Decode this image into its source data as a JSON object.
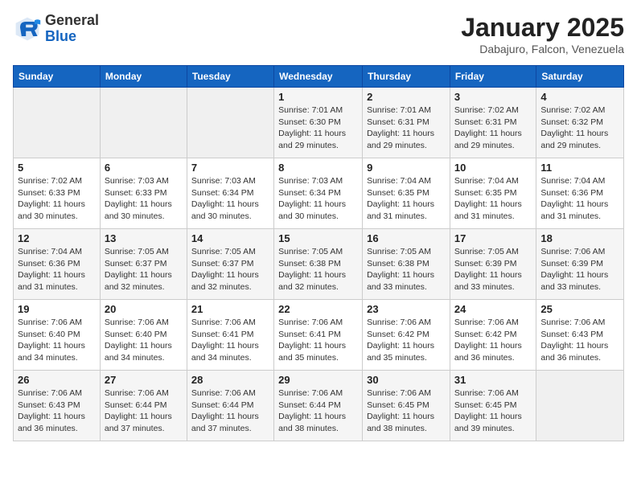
{
  "header": {
    "logo_general": "General",
    "logo_blue": "Blue",
    "title": "January 2025",
    "subtitle": "Dabajuro, Falcon, Venezuela"
  },
  "weekdays": [
    "Sunday",
    "Monday",
    "Tuesday",
    "Wednesday",
    "Thursday",
    "Friday",
    "Saturday"
  ],
  "weeks": [
    [
      {
        "day": "",
        "info": ""
      },
      {
        "day": "",
        "info": ""
      },
      {
        "day": "",
        "info": ""
      },
      {
        "day": "1",
        "info": "Sunrise: 7:01 AM\nSunset: 6:30 PM\nDaylight: 11 hours and 29 minutes."
      },
      {
        "day": "2",
        "info": "Sunrise: 7:01 AM\nSunset: 6:31 PM\nDaylight: 11 hours and 29 minutes."
      },
      {
        "day": "3",
        "info": "Sunrise: 7:02 AM\nSunset: 6:31 PM\nDaylight: 11 hours and 29 minutes."
      },
      {
        "day": "4",
        "info": "Sunrise: 7:02 AM\nSunset: 6:32 PM\nDaylight: 11 hours and 29 minutes."
      }
    ],
    [
      {
        "day": "5",
        "info": "Sunrise: 7:02 AM\nSunset: 6:33 PM\nDaylight: 11 hours and 30 minutes."
      },
      {
        "day": "6",
        "info": "Sunrise: 7:03 AM\nSunset: 6:33 PM\nDaylight: 11 hours and 30 minutes."
      },
      {
        "day": "7",
        "info": "Sunrise: 7:03 AM\nSunset: 6:34 PM\nDaylight: 11 hours and 30 minutes."
      },
      {
        "day": "8",
        "info": "Sunrise: 7:03 AM\nSunset: 6:34 PM\nDaylight: 11 hours and 30 minutes."
      },
      {
        "day": "9",
        "info": "Sunrise: 7:04 AM\nSunset: 6:35 PM\nDaylight: 11 hours and 31 minutes."
      },
      {
        "day": "10",
        "info": "Sunrise: 7:04 AM\nSunset: 6:35 PM\nDaylight: 11 hours and 31 minutes."
      },
      {
        "day": "11",
        "info": "Sunrise: 7:04 AM\nSunset: 6:36 PM\nDaylight: 11 hours and 31 minutes."
      }
    ],
    [
      {
        "day": "12",
        "info": "Sunrise: 7:04 AM\nSunset: 6:36 PM\nDaylight: 11 hours and 31 minutes."
      },
      {
        "day": "13",
        "info": "Sunrise: 7:05 AM\nSunset: 6:37 PM\nDaylight: 11 hours and 32 minutes."
      },
      {
        "day": "14",
        "info": "Sunrise: 7:05 AM\nSunset: 6:37 PM\nDaylight: 11 hours and 32 minutes."
      },
      {
        "day": "15",
        "info": "Sunrise: 7:05 AM\nSunset: 6:38 PM\nDaylight: 11 hours and 32 minutes."
      },
      {
        "day": "16",
        "info": "Sunrise: 7:05 AM\nSunset: 6:38 PM\nDaylight: 11 hours and 33 minutes."
      },
      {
        "day": "17",
        "info": "Sunrise: 7:05 AM\nSunset: 6:39 PM\nDaylight: 11 hours and 33 minutes."
      },
      {
        "day": "18",
        "info": "Sunrise: 7:06 AM\nSunset: 6:39 PM\nDaylight: 11 hours and 33 minutes."
      }
    ],
    [
      {
        "day": "19",
        "info": "Sunrise: 7:06 AM\nSunset: 6:40 PM\nDaylight: 11 hours and 34 minutes."
      },
      {
        "day": "20",
        "info": "Sunrise: 7:06 AM\nSunset: 6:40 PM\nDaylight: 11 hours and 34 minutes."
      },
      {
        "day": "21",
        "info": "Sunrise: 7:06 AM\nSunset: 6:41 PM\nDaylight: 11 hours and 34 minutes."
      },
      {
        "day": "22",
        "info": "Sunrise: 7:06 AM\nSunset: 6:41 PM\nDaylight: 11 hours and 35 minutes."
      },
      {
        "day": "23",
        "info": "Sunrise: 7:06 AM\nSunset: 6:42 PM\nDaylight: 11 hours and 35 minutes."
      },
      {
        "day": "24",
        "info": "Sunrise: 7:06 AM\nSunset: 6:42 PM\nDaylight: 11 hours and 36 minutes."
      },
      {
        "day": "25",
        "info": "Sunrise: 7:06 AM\nSunset: 6:43 PM\nDaylight: 11 hours and 36 minutes."
      }
    ],
    [
      {
        "day": "26",
        "info": "Sunrise: 7:06 AM\nSunset: 6:43 PM\nDaylight: 11 hours and 36 minutes."
      },
      {
        "day": "27",
        "info": "Sunrise: 7:06 AM\nSunset: 6:44 PM\nDaylight: 11 hours and 37 minutes."
      },
      {
        "day": "28",
        "info": "Sunrise: 7:06 AM\nSunset: 6:44 PM\nDaylight: 11 hours and 37 minutes."
      },
      {
        "day": "29",
        "info": "Sunrise: 7:06 AM\nSunset: 6:44 PM\nDaylight: 11 hours and 38 minutes."
      },
      {
        "day": "30",
        "info": "Sunrise: 7:06 AM\nSunset: 6:45 PM\nDaylight: 11 hours and 38 minutes."
      },
      {
        "day": "31",
        "info": "Sunrise: 7:06 AM\nSunset: 6:45 PM\nDaylight: 11 hours and 39 minutes."
      },
      {
        "day": "",
        "info": ""
      }
    ]
  ]
}
